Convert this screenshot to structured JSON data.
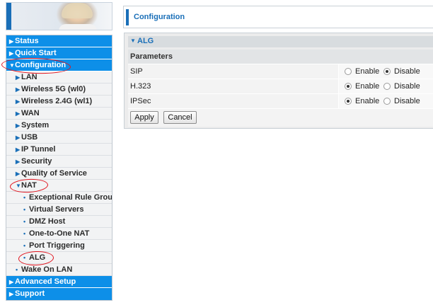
{
  "sidebar": {
    "items": [
      {
        "label": "Status",
        "arrow": "▶",
        "level": "top"
      },
      {
        "label": "Quick Start",
        "arrow": "▶",
        "level": "top"
      },
      {
        "label": "Configuration",
        "arrow": "▼",
        "level": "top"
      },
      {
        "label": "LAN",
        "arrow": "▶",
        "level": "sub"
      },
      {
        "label": "Wireless 5G (wl0)",
        "arrow": "▶",
        "level": "sub"
      },
      {
        "label": "Wireless 2.4G (wl1)",
        "arrow": "▶",
        "level": "sub"
      },
      {
        "label": "WAN",
        "arrow": "▶",
        "level": "sub"
      },
      {
        "label": "System",
        "arrow": "▶",
        "level": "sub"
      },
      {
        "label": "USB",
        "arrow": "▶",
        "level": "sub"
      },
      {
        "label": "IP Tunnel",
        "arrow": "▶",
        "level": "sub"
      },
      {
        "label": "Security",
        "arrow": "▶",
        "level": "sub"
      },
      {
        "label": "Quality of Service",
        "arrow": "▶",
        "level": "sub"
      },
      {
        "label": "NAT",
        "arrow": "▼",
        "level": "sub"
      },
      {
        "label": "Exceptional Rule Group",
        "arrow": "•",
        "level": "subsub"
      },
      {
        "label": "Virtual Servers",
        "arrow": "•",
        "level": "subsub"
      },
      {
        "label": "DMZ Host",
        "arrow": "•",
        "level": "subsub"
      },
      {
        "label": "One-to-One NAT",
        "arrow": "•",
        "level": "subsub"
      },
      {
        "label": "Port Triggering",
        "arrow": "•",
        "level": "subsub"
      },
      {
        "label": "ALG",
        "arrow": "•",
        "level": "subsub"
      },
      {
        "label": "Wake On LAN",
        "arrow": "•",
        "level": "sub"
      },
      {
        "label": "Advanced Setup",
        "arrow": "▶",
        "level": "top"
      },
      {
        "label": "Support",
        "arrow": "▶",
        "level": "top"
      }
    ]
  },
  "page": {
    "title": "Configuration"
  },
  "alg": {
    "header": "ALG",
    "header_icon": "caret-down-icon",
    "table_header": "Parameters",
    "option_enable": "Enable",
    "option_disable": "Disable",
    "rows": [
      {
        "name": "SIP",
        "selected": "Disable"
      },
      {
        "name": "H.323",
        "selected": "Enable"
      },
      {
        "name": "IPSec",
        "selected": "Enable"
      }
    ],
    "apply_label": "Apply",
    "cancel_label": "Cancel"
  },
  "colors": {
    "accent": "#1a6fb8",
    "menu_blue": "#0d8fe8",
    "annotation_red": "#e0141e"
  }
}
